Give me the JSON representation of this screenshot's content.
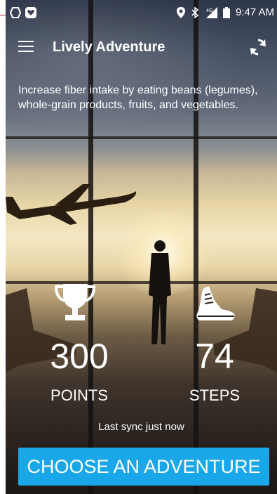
{
  "status_bar": {
    "time": "9:47 AM",
    "left_icons": [
      "hexagon-outline-icon",
      "heart-badge-icon"
    ],
    "right_icons": [
      "location-pin-icon",
      "bluetooth-icon",
      "signal-4g-icon",
      "battery-icon"
    ]
  },
  "toolbar": {
    "title": "Lively Adventure",
    "menu_icon": "menu-icon",
    "sync_icon": "sync-icon"
  },
  "tip": {
    "text": "Increase fiber intake by eating beans (legumes), whole-grain products, fruits, and vegetables."
  },
  "stats": {
    "points": {
      "value": "300",
      "label": "POINTS",
      "icon": "trophy-icon"
    },
    "steps": {
      "value": "74",
      "label": "STEPS",
      "icon": "sneaker-icon"
    }
  },
  "sync": {
    "text": "Last sync just now"
  },
  "cta": {
    "label": "CHOOSE AN ADVENTURE",
    "color": "#1aa7ea"
  }
}
